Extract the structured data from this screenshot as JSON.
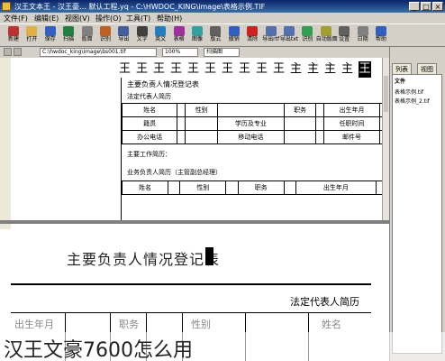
{
  "window": {
    "title": "汉王文本王 - 汉王豪…  默认工程.yq - C:\\HWDOC_KING\\image\\表格示例.TIF",
    "minimize": "_",
    "maximize": "□",
    "close": "×"
  },
  "menu": [
    "文件(F)",
    "编辑(E)",
    "视图(V)",
    "操作(O)",
    "工具(T)",
    "帮助(H)"
  ],
  "toolbar": [
    {
      "label": "新建",
      "color": "#c03030"
    },
    {
      "label": "打开",
      "color": "#e0b040"
    },
    {
      "label": "保存",
      "color": "#3060c0"
    },
    {
      "label": "扫描",
      "color": "#208040"
    },
    {
      "label": "版面",
      "color": "#808080"
    },
    {
      "label": "识别",
      "color": "#c06020"
    },
    {
      "label": "导出",
      "color": "#4060a0"
    },
    {
      "label": "文字",
      "color": "#404040"
    },
    {
      "label": "英文",
      "color": "#2080c0"
    },
    {
      "label": "表格",
      "color": "#a030a0"
    },
    {
      "label": "图像",
      "color": "#30a0a0"
    },
    {
      "label": "版式",
      "color": "#606060"
    },
    {
      "label": "撤销",
      "color": "#3060c0"
    },
    {
      "label": "清除",
      "color": "#d02020"
    },
    {
      "label": "导出rtf",
      "color": "#5070b0"
    },
    {
      "label": "导出txt",
      "color": "#5070b0"
    },
    {
      "label": "识别",
      "color": "#30a050"
    },
    {
      "label": "自动版面",
      "color": "#a0a030"
    },
    {
      "label": "设置",
      "color": "#606060"
    },
    {
      "label": "日期",
      "color": "#808080"
    },
    {
      "label": "帮助",
      "color": "#3060c0"
    }
  ],
  "addressbar": {
    "path": "C:\\hwdoc_king\\image\\bs001.tif",
    "zoom": "100%",
    "view": "扫描图"
  },
  "ocr_chars": [
    "王",
    "王",
    "王",
    "王",
    "王",
    "王",
    "王",
    "王",
    "王",
    "王",
    "主",
    "主",
    "主",
    "主",
    "王"
  ],
  "document": {
    "title": "主要负责人情况登记表",
    "sec1": "法定代表人简历",
    "rows1": [
      [
        "姓名",
        "",
        "性别",
        "",
        "职务",
        "",
        "出生年月",
        ""
      ],
      [
        "籍贯",
        "",
        "",
        "学历及专业",
        "",
        "",
        "任职时间",
        ""
      ],
      [
        "办公电话",
        "",
        "",
        "移动电话",
        "",
        "",
        "邮件号",
        ""
      ]
    ],
    "sec2": "主要工作简历：",
    "sec3": "业务负责人简历（主管副总经理）",
    "rows2": [
      [
        "姓名",
        "",
        "性别",
        "",
        "职务",
        "",
        "出生年月",
        ""
      ]
    ]
  },
  "zoom": {
    "title": "主要负责人情况登记表",
    "section": "法定代表人简历",
    "cells": [
      "姓名",
      "性别",
      "职务",
      "出生年月"
    ]
  },
  "right_panel": {
    "tabs": [
      "列表",
      "视图"
    ],
    "header": "文件",
    "items": [
      "表格示例.tif",
      "表格示例_2.tif"
    ]
  },
  "caption": "汉王文豪7600怎么用"
}
